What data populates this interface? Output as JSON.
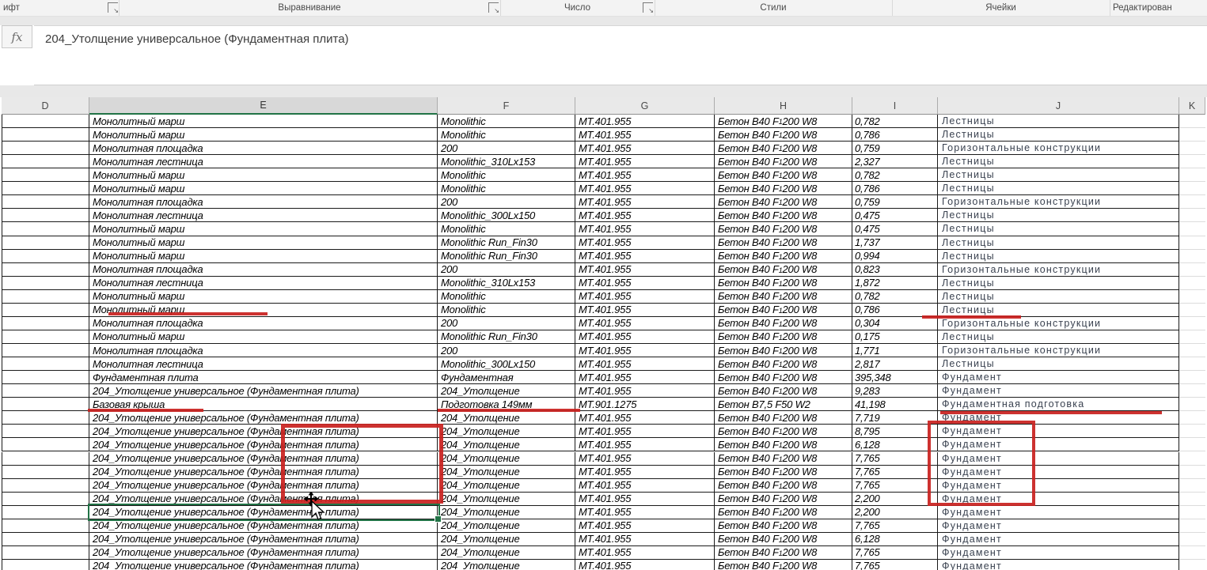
{
  "ribbon": {
    "groups": [
      {
        "label": "ифт",
        "has_launcher": true
      },
      {
        "label": "Выравнивание",
        "has_launcher": true
      },
      {
        "label": "Число",
        "has_launcher": true
      },
      {
        "label": "Стили",
        "has_launcher": false
      },
      {
        "label": "Ячейки",
        "has_launcher": false
      },
      {
        "label": "Редактирован",
        "has_launcher": false
      }
    ]
  },
  "formula_bar": {
    "fx_label": "fx",
    "value": "204_Утолщение универсальное (Фундаментная плита)"
  },
  "grid": {
    "column_headers": [
      "D",
      "E",
      "F",
      "G",
      "H",
      "I",
      "J",
      "K"
    ],
    "selected_column": "E",
    "selected_row_index": 29
  },
  "defaults": {
    "code": "МТ.401.955",
    "concrete_pre": "Бетон B40 F",
    "concrete_sub": "1",
    "concrete_post": "200 W8"
  },
  "rows": [
    {
      "e": "Монолитный марш",
      "f": "Monolithic",
      "g": "МТ.401.955",
      "h1": "Бетон B40 F",
      "hsub": "1",
      "h2": "200 W8",
      "i": "0,782",
      "j": "Лестницы"
    },
    {
      "e": "Монолитный марш",
      "f": "Monolithic",
      "g": "МТ.401.955",
      "h1": "Бетон B40 F",
      "hsub": "1",
      "h2": "200 W8",
      "i": "0,786",
      "j": "Лестницы"
    },
    {
      "e": "Монолитная площадка",
      "f": "200",
      "g": "МТ.401.955",
      "h1": "Бетон B40 F",
      "hsub": "1",
      "h2": "200 W8",
      "i": "0,759",
      "j": "Горизонтальные конструкции"
    },
    {
      "e": "Монолитная лестница",
      "f": "Monolithic_310Lx153",
      "g": "МТ.401.955",
      "h1": "Бетон B40 F",
      "hsub": "1",
      "h2": "200 W8",
      "i": "2,327",
      "j": "Лестницы"
    },
    {
      "e": "Монолитный марш",
      "f": "Monolithic",
      "g": "МТ.401.955",
      "h1": "Бетон B40 F",
      "hsub": "1",
      "h2": "200 W8",
      "i": "0,782",
      "j": "Лестницы"
    },
    {
      "e": "Монолитный марш",
      "f": "Monolithic",
      "g": "МТ.401.955",
      "h1": "Бетон B40 F",
      "hsub": "1",
      "h2": "200 W8",
      "i": "0,786",
      "j": "Лестницы"
    },
    {
      "e": "Монолитная площадка",
      "f": "200",
      "g": "МТ.401.955",
      "h1": "Бетон B40 F",
      "hsub": "1",
      "h2": "200 W8",
      "i": "0,759",
      "j": "Горизонтальные конструкции"
    },
    {
      "e": "Монолитная лестница",
      "f": "Monolithic_300Lx150",
      "g": "МТ.401.955",
      "h1": "Бетон B40 F",
      "hsub": "1",
      "h2": "200 W8",
      "i": "0,475",
      "j": "Лестницы"
    },
    {
      "e": "Монолитный марш",
      "f": "Monolithic",
      "g": "МТ.401.955",
      "h1": "Бетон B40 F",
      "hsub": "1",
      "h2": "200 W8",
      "i": "0,475",
      "j": "Лестницы"
    },
    {
      "e": "Монолитный марш",
      "f": "Monolithic Run_Fin30",
      "g": "МТ.401.955",
      "h1": "Бетон B40 F",
      "hsub": "1",
      "h2": "200 W8",
      "i": "1,737",
      "j": "Лестницы"
    },
    {
      "e": "Монолитный марш",
      "f": "Monolithic Run_Fin30",
      "g": "МТ.401.955",
      "h1": "Бетон B40 F",
      "hsub": "1",
      "h2": "200 W8",
      "i": "0,994",
      "j": "Лестницы"
    },
    {
      "e": "Монолитная площадка",
      "f": "200",
      "g": "МТ.401.955",
      "h1": "Бетон B40 F",
      "hsub": "1",
      "h2": "200 W8",
      "i": "0,823",
      "j": "Горизонтальные конструкции"
    },
    {
      "e": "Монолитная лестница",
      "f": "Monolithic_310Lx153",
      "g": "МТ.401.955",
      "h1": "Бетон B40 F",
      "hsub": "1",
      "h2": "200 W8",
      "i": "1,872",
      "j": "Лестницы"
    },
    {
      "e": "Монолитный марш",
      "f": "Monolithic",
      "g": "МТ.401.955",
      "h1": "Бетон B40 F",
      "hsub": "1",
      "h2": "200 W8",
      "i": "0,782",
      "j": "Лестницы"
    },
    {
      "e": "Монолитный марш",
      "f": "Monolithic",
      "g": "МТ.401.955",
      "h1": "Бетон B40 F",
      "hsub": "1",
      "h2": "200 W8",
      "i": "0,786",
      "j": "Лестницы"
    },
    {
      "e": "Монолитная площадка",
      "f": "200",
      "g": "МТ.401.955",
      "h1": "Бетон B40 F",
      "hsub": "1",
      "h2": "200 W8",
      "i": "0,304",
      "j": "Горизонтальные конструкции"
    },
    {
      "e": "Монолитный марш",
      "f": "Monolithic Run_Fin30",
      "g": "МТ.401.955",
      "h1": "Бетон B40 F",
      "hsub": "1",
      "h2": "200 W8",
      "i": "0,175",
      "j": "Лестницы"
    },
    {
      "e": "Монолитная площадка",
      "f": "200",
      "g": "МТ.401.955",
      "h1": "Бетон B40 F",
      "hsub": "1",
      "h2": "200 W8",
      "i": "1,771",
      "j": "Горизонтальные конструкции"
    },
    {
      "e": "Монолитная лестница",
      "f": "Monolithic_300Lx150",
      "g": "МТ.401.955",
      "h1": "Бетон B40 F",
      "hsub": "1",
      "h2": "200 W8",
      "i": "2,817",
      "j": "Лестницы"
    },
    {
      "e": "Фундаментная плита",
      "f": "Фундаментная",
      "g": "МТ.401.955",
      "h1": "Бетон B40 F",
      "hsub": "1",
      "h2": "200 W8",
      "i": "395,348",
      "j": "Фундамент"
    },
    {
      "e": "204_Утолщение универсальное (Фундаментная плита)",
      "f": "204_Утолщение",
      "g": "МТ.401.955",
      "h1": "Бетон B40 F",
      "hsub": "1",
      "h2": "200 W8",
      "i": "9,283",
      "j": "Фундамент"
    },
    {
      "e": "Базовая крыша",
      "f": "Подготовка 149мм",
      "g": "МТ.901.1275",
      "h1": "Бетон B7,5 F50 W2",
      "hsub": "",
      "h2": "",
      "i": "41,198",
      "j": "Фундаментная подготовка"
    },
    {
      "e": "204_Утолщение универсальное (Фундаментная плита)",
      "f": "204_Утолщение",
      "g": "МТ.401.955",
      "h1": "Бетон B40 F",
      "hsub": "1",
      "h2": "200 W8",
      "i": "7,719",
      "j": "Фундамент"
    },
    {
      "e": "204_Утолщение универсальное (Фундаментная плита)",
      "f": "204_Утолщение",
      "g": "МТ.401.955",
      "h1": "Бетон B40 F",
      "hsub": "1",
      "h2": "200 W8",
      "i": "8,795",
      "j": "Фундамент"
    },
    {
      "e": "204_Утолщение универсальное (Фундаментная плита)",
      "f": "204_Утолщение",
      "g": "МТ.401.955",
      "h1": "Бетон B40 F",
      "hsub": "1",
      "h2": "200 W8",
      "i": "6,128",
      "j": "Фундамент"
    },
    {
      "e": "204_Утолщение универсальное (Фундаментная плита)",
      "f": "204_Утолщение",
      "g": "МТ.401.955",
      "h1": "Бетон B40 F",
      "hsub": "1",
      "h2": "200 W8",
      "i": "7,765",
      "j": "Фундамент"
    },
    {
      "e": "204_Утолщение универсальное (Фундаментная плита)",
      "f": "204_Утолщение",
      "g": "МТ.401.955",
      "h1": "Бетон B40 F",
      "hsub": "1",
      "h2": "200 W8",
      "i": "7,765",
      "j": "Фундамент"
    },
    {
      "e": "204_Утолщение универсальное (Фундаментная плита)",
      "f": "204_Утолщение",
      "g": "МТ.401.955",
      "h1": "Бетон B40 F",
      "hsub": "1",
      "h2": "200 W8",
      "i": "7,765",
      "j": "Фундамент"
    },
    {
      "e": "204_Утолщение универсальное (Фундаментная плита)",
      "f": "204_Утолщение",
      "g": "МТ.401.955",
      "h1": "Бетон B40 F",
      "hsub": "1",
      "h2": "200 W8",
      "i": "2,200",
      "j": "Фундамент"
    },
    {
      "e": "204_Утолщение универсальное (Фундаментная плита)",
      "f": "204_Утолщение",
      "g": "МТ.401.955",
      "h1": "Бетон B40 F",
      "hsub": "1",
      "h2": "200 W8",
      "i": "2,200",
      "j": "Фундамент"
    },
    {
      "e": "204_Утолщение универсальное (Фундаментная плита)",
      "f": "204_Утолщение",
      "g": "МТ.401.955",
      "h1": "Бетон B40 F",
      "hsub": "1",
      "h2": "200 W8",
      "i": "7,765",
      "j": "Фундамент"
    },
    {
      "e": "204_Утолщение универсальное (Фундаментная плита)",
      "f": "204_Утолщение",
      "g": "МТ.401.955",
      "h1": "Бетон B40 F",
      "hsub": "1",
      "h2": "200 W8",
      "i": "6,128",
      "j": "Фундамент"
    },
    {
      "e": "204_Утолщение универсальное (Фундаментная плита)",
      "f": "204_Утолщение",
      "g": "МТ.401.955",
      "h1": "Бетон B40 F",
      "hsub": "1",
      "h2": "200 W8",
      "i": "7,765",
      "j": "Фундамент"
    },
    {
      "e": "204_Утолщение универсальное (Фундаментная плита)",
      "f": "204_Утолщение",
      "g": "МТ.401.955",
      "h1": "Бетон B40 F",
      "hsub": "1",
      "h2": "200 W8",
      "i": "7,765",
      "j": "Фундамент"
    }
  ],
  "colors": {
    "selection_green": "#217346",
    "annotation_red": "#c9211e",
    "grid_border": "#1a1a1a",
    "category_text": "#3a4250"
  }
}
